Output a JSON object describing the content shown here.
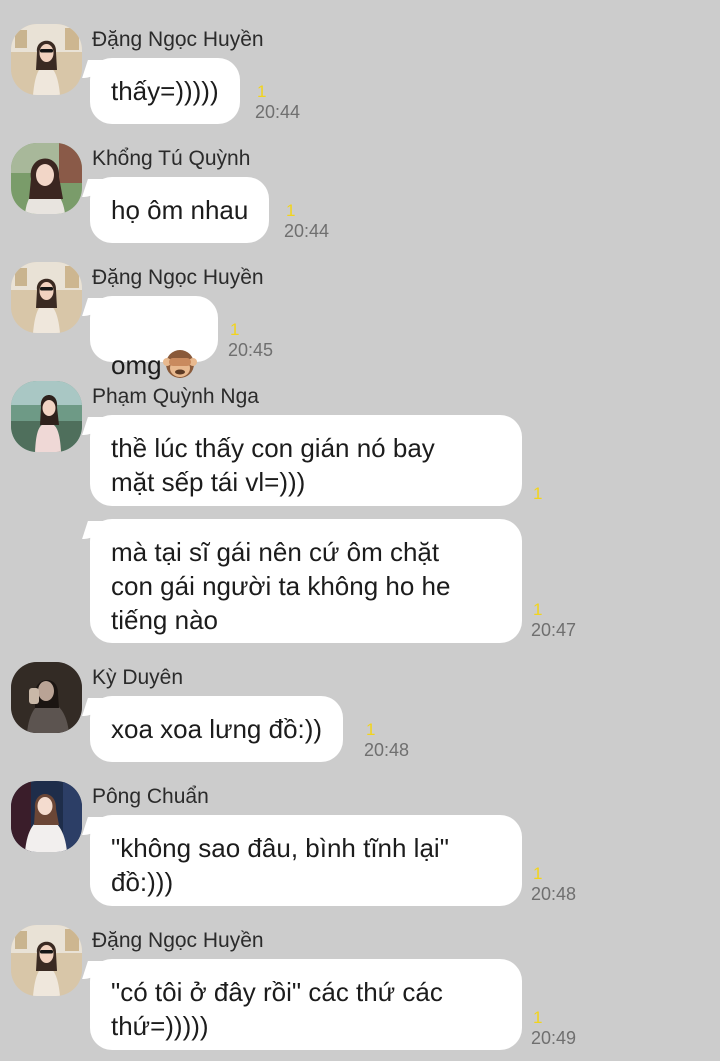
{
  "messages": [
    {
      "sender": "Đặng Ngọc Huyền",
      "avatar": "avatar-girl-sunglasses",
      "bubbles": [
        {
          "text": "thấy=)))))",
          "read": "1",
          "time": "20:44"
        }
      ]
    },
    {
      "sender": "Khổng Tú Quỳnh",
      "avatar": "avatar-girl-outdoor",
      "bubbles": [
        {
          "text": "họ ôm nhau",
          "read": "1",
          "time": "20:44"
        }
      ]
    },
    {
      "sender": "Đặng Ngọc Huyền",
      "avatar": "avatar-girl-sunglasses",
      "bubbles": [
        {
          "text": "omg",
          "emoji": "see-no-evil-monkey-emoji",
          "read": "1",
          "time": "20:45"
        }
      ]
    },
    {
      "sender": "Phạm Quỳnh Nga",
      "avatar": "avatar-girl-lake",
      "bubbles": [
        {
          "text": "thề lúc thấy con gián nó bay\nmặt sếp tái vl=)))",
          "read": "1",
          "time": ""
        },
        {
          "text": "mà tại sĩ gái nên cứ ôm chặt\ncon gái người ta không ho he\ntiếng nào",
          "read": "1",
          "time": "20:47"
        }
      ]
    },
    {
      "sender": "Kỳ Duyên",
      "avatar": "avatar-dark-portrait",
      "bubbles": [
        {
          "text": "xoa xoa lưng đồ:))",
          "read": "1",
          "time": "20:48"
        }
      ]
    },
    {
      "sender": "Pông Chuẩn",
      "avatar": "avatar-girl-stage",
      "bubbles": [
        {
          "text": "\"không sao đâu, bình tĩnh lại\"\nđồ:)))",
          "read": "1",
          "time": "20:48"
        }
      ]
    },
    {
      "sender": "Đặng Ngọc Huyền",
      "avatar": "avatar-girl-sunglasses",
      "bubbles": [
        {
          "text": "\"có tôi ở đây rồi\" các thứ các\nthứ=)))))",
          "read": "1",
          "time": "20:49"
        }
      ]
    }
  ],
  "colors": {
    "background": "#cccccc",
    "bubble": "#ffffff",
    "read_count": "#f2d41c",
    "timestamp": "#6f6f6f"
  }
}
